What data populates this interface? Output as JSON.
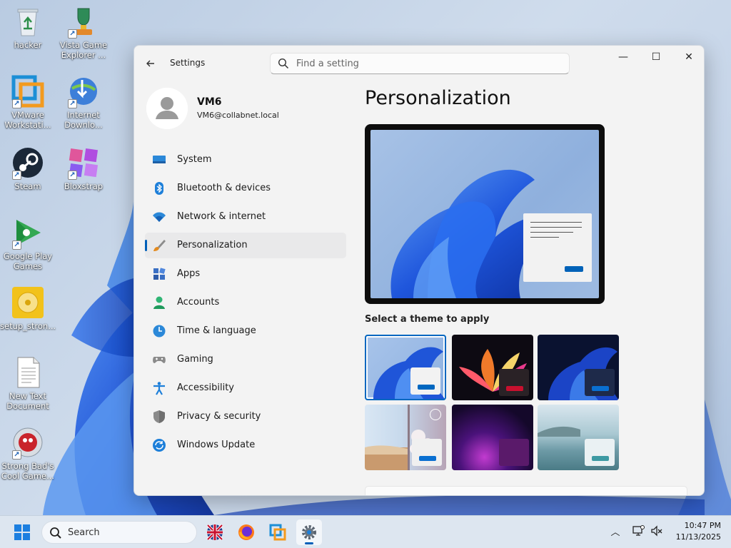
{
  "desktop": {
    "icons": [
      {
        "label": "hacker"
      },
      {
        "label": "Vista Game Explorer ..."
      },
      {
        "label": "VMware Workstati..."
      },
      {
        "label": "Internet Downlo..."
      },
      {
        "label": "Steam"
      },
      {
        "label": "Bloxstrap"
      },
      {
        "label": "Google Play Games"
      },
      {
        "label": "setup_stron..."
      },
      {
        "label": "New Text Document"
      },
      {
        "label": "Strong Bad's Cool Game..."
      }
    ]
  },
  "window": {
    "title": "Settings",
    "search_placeholder": "Find a setting",
    "controls": {
      "minimize": "—",
      "maximize": "☐",
      "close": "✕"
    }
  },
  "account": {
    "name": "VM6",
    "email": "VM6@collabnet.local"
  },
  "nav": {
    "items": [
      {
        "label": "System",
        "icon": "monitor-icon"
      },
      {
        "label": "Bluetooth & devices",
        "icon": "bluetooth-icon"
      },
      {
        "label": "Network & internet",
        "icon": "wifi-icon"
      },
      {
        "label": "Personalization",
        "icon": "brush-icon",
        "selected": true
      },
      {
        "label": "Apps",
        "icon": "apps-icon"
      },
      {
        "label": "Accounts",
        "icon": "person-icon"
      },
      {
        "label": "Time & language",
        "icon": "globe-clock-icon"
      },
      {
        "label": "Gaming",
        "icon": "gamepad-icon"
      },
      {
        "label": "Accessibility",
        "icon": "accessibility-icon"
      },
      {
        "label": "Privacy & security",
        "icon": "shield-icon"
      },
      {
        "label": "Windows Update",
        "icon": "update-icon"
      }
    ]
  },
  "content": {
    "title": "Personalization",
    "theme_label": "Select a theme to apply",
    "themes": [
      {
        "name": "windows-light",
        "selected": true,
        "accent": "#0067c0"
      },
      {
        "name": "glow",
        "accent": "#c8102e"
      },
      {
        "name": "windows-dark",
        "accent": "#0a6fd1"
      },
      {
        "name": "captured-motion",
        "accent": "#0a6fd1"
      },
      {
        "name": "sunrise",
        "accent": "#5a1a6a"
      },
      {
        "name": "flow",
        "accent": "#3c9aa3"
      }
    ]
  },
  "taskbar": {
    "search_label": "Search",
    "time": "10:47 PM",
    "date": "11/13/2025"
  },
  "colors": {
    "accent": "#005fb8",
    "window_bg": "#f3f3f3",
    "taskbar_bg": "#dde6f0"
  }
}
